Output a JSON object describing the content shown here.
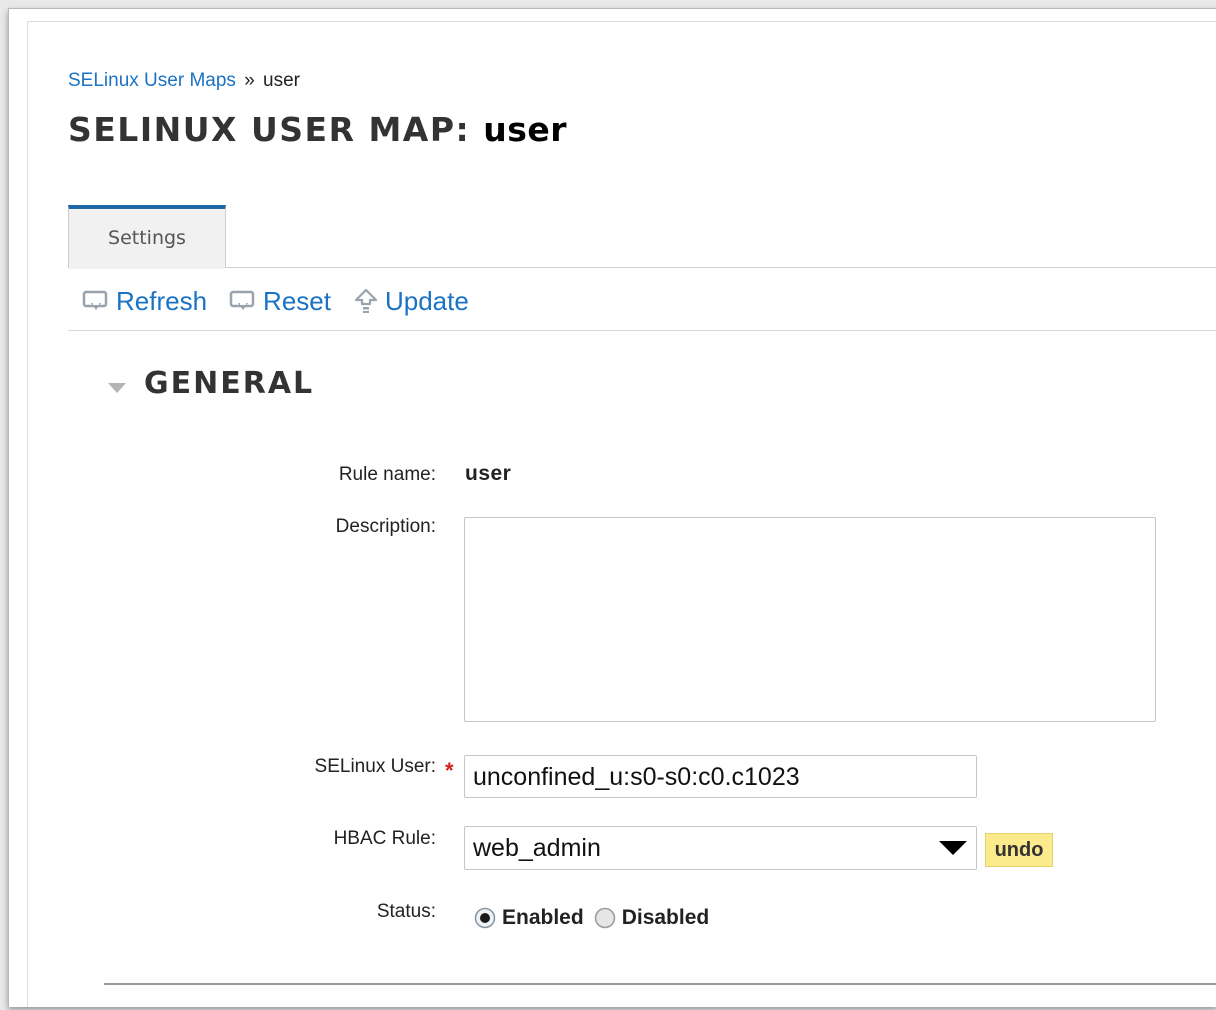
{
  "breadcrumb": {
    "parent": "SELinux User Maps",
    "separator": "»",
    "current": "user"
  },
  "title": {
    "prefix": "SELINUX USER MAP:",
    "entity": "user"
  },
  "tabs": [
    {
      "label": "Settings",
      "active": true
    }
  ],
  "toolbar": {
    "refresh_label": "Refresh",
    "reset_label": "Reset",
    "update_label": "Update"
  },
  "section": {
    "title": "GENERAL",
    "expanded": true
  },
  "form": {
    "rule_name_label": "Rule name:",
    "rule_name_value": "user",
    "description_label": "Description:",
    "description_value": "",
    "selinux_user_label": "SELinux User:",
    "selinux_user_value": "unconfined_u:s0-s0:c0.c1023",
    "required_marker": "*",
    "hbac_rule_label": "HBAC Rule:",
    "hbac_rule_value": "web_admin",
    "undo_label": "undo",
    "status_label": "Status:",
    "status_options": [
      "Enabled",
      "Disabled"
    ],
    "status_selected": "Enabled"
  },
  "colors": {
    "link": "#1c73c4",
    "tab_accent": "#1c68a8",
    "required": "#d62020",
    "undo_bg": "#fbeb8d"
  }
}
